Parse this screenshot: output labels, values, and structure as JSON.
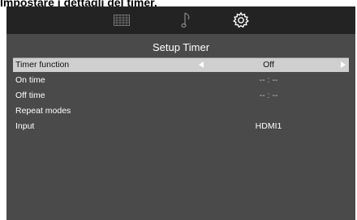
{
  "heading": "Impostare i dettagli del timer.",
  "tabs": [
    {
      "icon": "grid-icon"
    },
    {
      "icon": "music-note-icon"
    },
    {
      "icon": "gear-icon",
      "active": true
    }
  ],
  "menu": {
    "title": "Setup Timer",
    "rows": [
      {
        "label": "Timer function",
        "value": "Off"
      },
      {
        "label": "On time",
        "value": "-- : --"
      },
      {
        "label": "Off time",
        "value": "-- : --"
      },
      {
        "label": "Repeat modes",
        "value": ""
      },
      {
        "label": "Input",
        "value": "HDMI1"
      }
    ]
  },
  "colors": {
    "panel": "#4a4a4a",
    "topbar": "#232323",
    "selected_row": "#cfcfcf"
  }
}
